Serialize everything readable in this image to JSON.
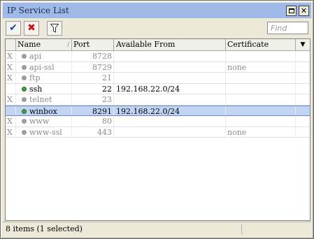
{
  "window": {
    "title": "IP Service List"
  },
  "toolbar": {
    "find_placeholder": "Find"
  },
  "columns": [
    "",
    "Name",
    "Port",
    "Available From",
    "Certificate"
  ],
  "rows": [
    {
      "flag": "X",
      "name": "api",
      "port": "8728",
      "available_from": "",
      "certificate": "",
      "state": "disabled"
    },
    {
      "flag": "X",
      "name": "api-ssl",
      "port": "8729",
      "available_from": "",
      "certificate": "none",
      "state": "disabled"
    },
    {
      "flag": "X",
      "name": "ftp",
      "port": "21",
      "available_from": "",
      "certificate": "",
      "state": "disabled"
    },
    {
      "flag": "",
      "name": "ssh",
      "port": "22",
      "available_from": "192.168.22.0/24",
      "certificate": "",
      "state": "enabled"
    },
    {
      "flag": "X",
      "name": "telnet",
      "port": "23",
      "available_from": "",
      "certificate": "",
      "state": "disabled"
    },
    {
      "flag": "",
      "name": "winbox",
      "port": "8291",
      "available_from": "192.168.22.0/24",
      "certificate": "",
      "state": "selected"
    },
    {
      "flag": "X",
      "name": "www",
      "port": "80",
      "available_from": "",
      "certificate": "",
      "state": "disabled"
    },
    {
      "flag": "X",
      "name": "www-ssl",
      "port": "443",
      "available_from": "",
      "certificate": "none",
      "state": "disabled"
    }
  ],
  "status": {
    "text": "8 items (1 selected)"
  },
  "colors": {
    "titlebar": "#9fb9e8",
    "selection": "#c1d4f3",
    "enabled_dot": "#3ca03c",
    "disabled_dot": "#9c9c9c"
  }
}
